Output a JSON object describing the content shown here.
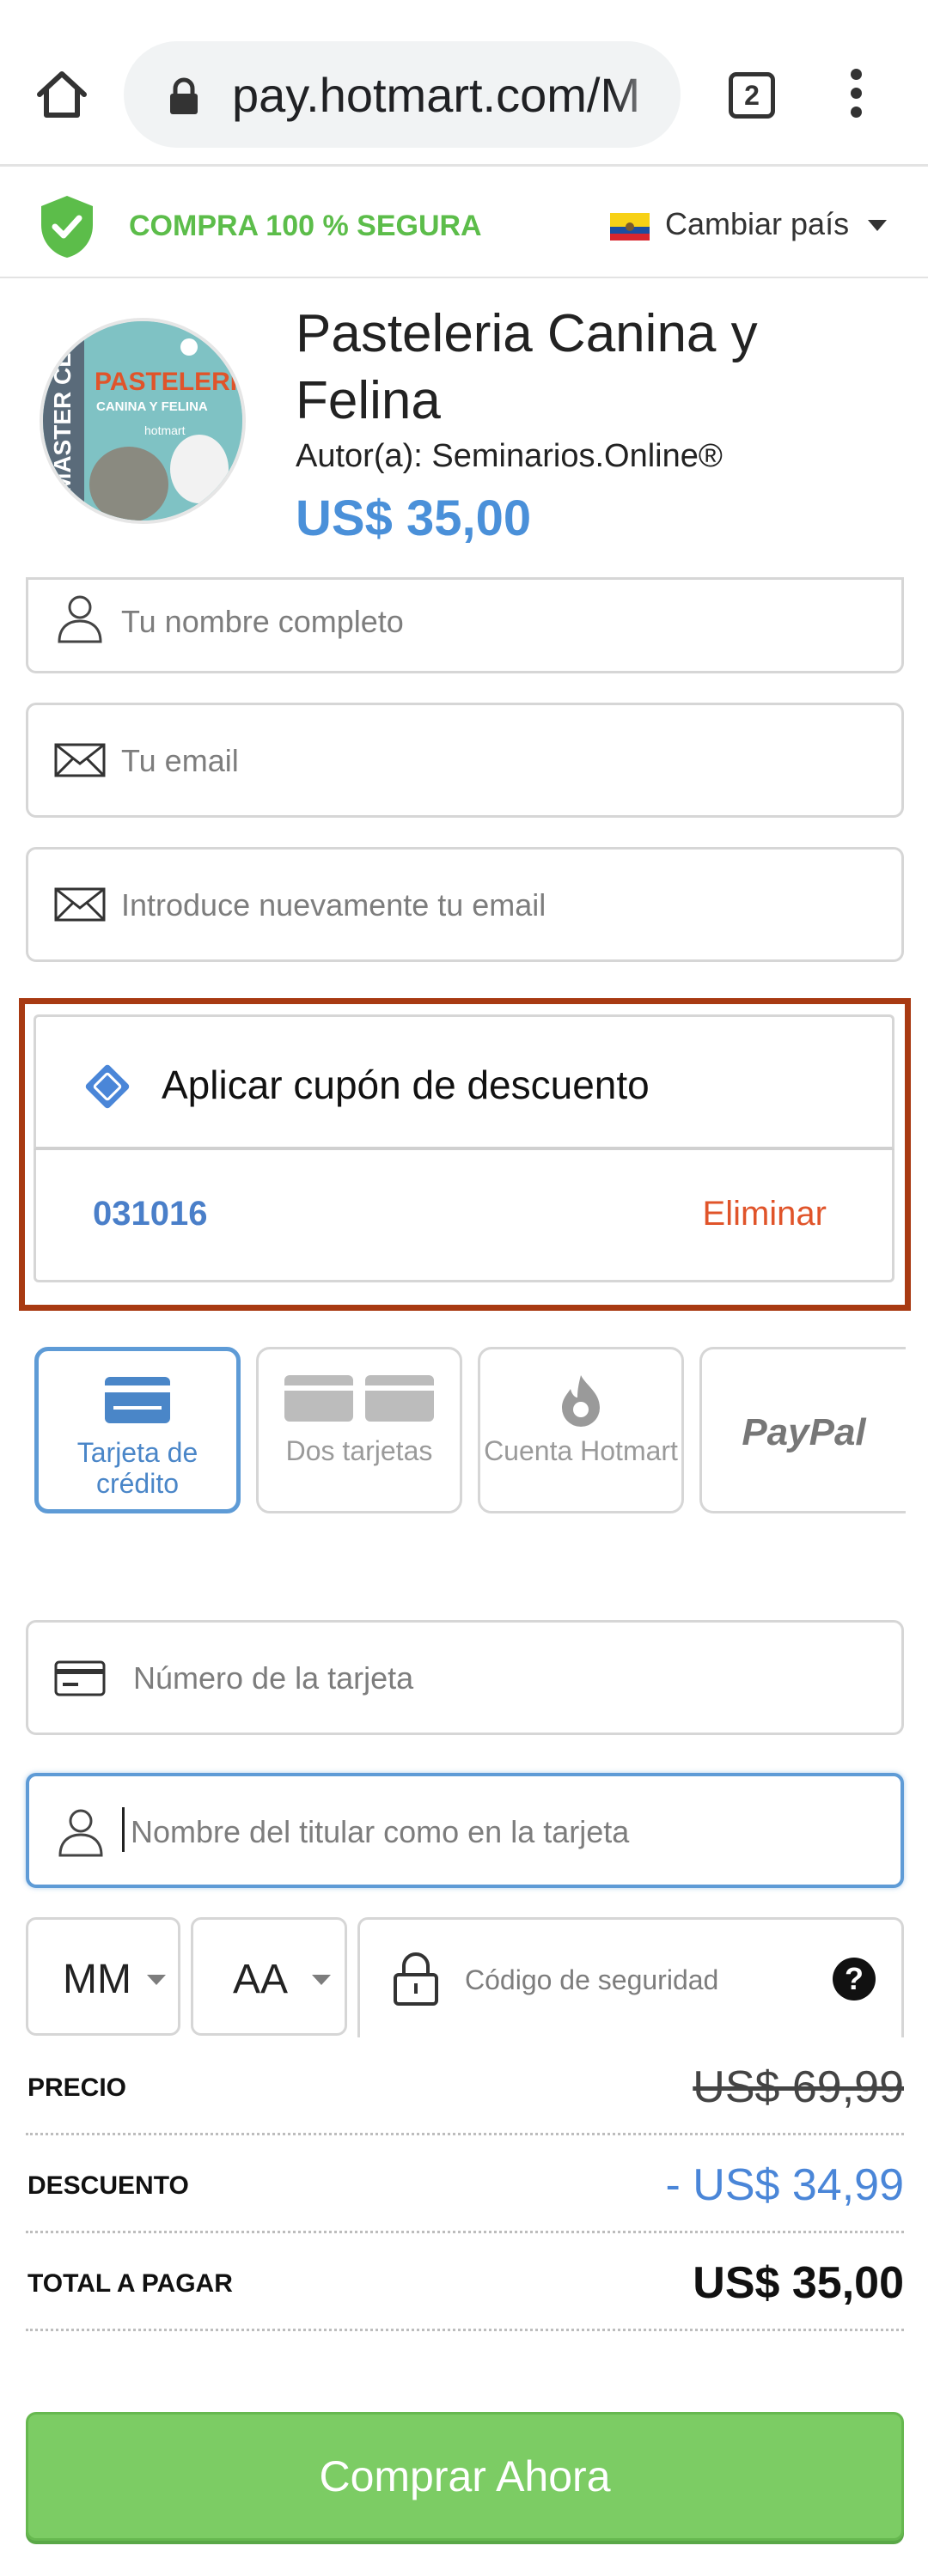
{
  "browser": {
    "url": "pay.hotmart.com/M",
    "tab_count": "2"
  },
  "secure": {
    "label": "COMPRA 100 % SEGURA",
    "change_country": "Cambiar país"
  },
  "product": {
    "title": "Pasteleria Canina y Felina",
    "author": "Autor(a): Seminarios.Online®",
    "price": "US$ 35,00",
    "image_lines": [
      "MASTER CLASS",
      "PASTELERÍA",
      "CANINA Y FELINA",
      "hotmart"
    ]
  },
  "form": {
    "name_placeholder": "Tu nombre completo",
    "email_placeholder": "Tu email",
    "email_confirm_placeholder": "Introduce nuevamente tu email"
  },
  "coupon": {
    "title": "Aplicar cupón de descuento",
    "code": "031016",
    "remove_label": "Eliminar"
  },
  "payment_methods": [
    {
      "label": "Tarjeta de crédito",
      "icon": "credit-card-icon",
      "active": true
    },
    {
      "label": "Dos tarjetas",
      "icon": "two-cards-icon",
      "active": false
    },
    {
      "label": "Cuenta Hotmart",
      "icon": "hotmart-flame-icon",
      "active": false
    },
    {
      "label": "PayPal",
      "icon": "paypal-logo",
      "active": false
    }
  ],
  "card": {
    "number_placeholder": "Número de la tarjeta",
    "holder_placeholder": "Nombre del titular como en la tarjeta",
    "month": "MM",
    "year": "AA",
    "cvc_placeholder": "Código de seguridad"
  },
  "summary": {
    "price_label": "PRECIO",
    "price_value": "US$ 69,99",
    "discount_label": "DESCUENTO",
    "discount_value": "- US$ 34,99",
    "total_label": "TOTAL A PAGAR",
    "total_value": "US$ 35,00"
  },
  "buy_button": "Comprar Ahora",
  "colors": {
    "accent_blue": "#4a90d9",
    "secure_green": "#5cbd4a",
    "buy_green": "#7ccc64",
    "coupon_frame": "#a83a12",
    "remove_orange": "#e0542a"
  }
}
